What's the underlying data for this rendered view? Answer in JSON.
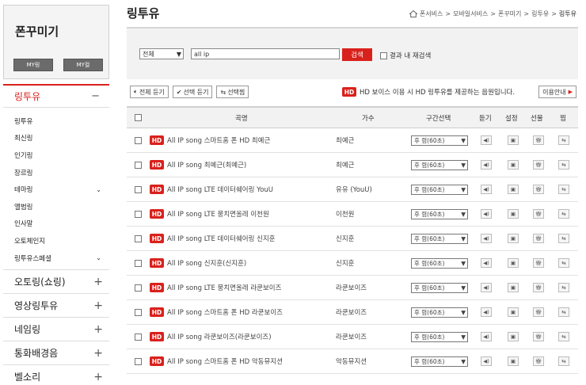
{
  "sidebar": {
    "title": "폰꾸미기",
    "btn1": "MY링",
    "btn2": "MY컬",
    "active_menu": {
      "label": "링투유",
      "sign": "−"
    },
    "sub_items": [
      {
        "label": "링투유",
        "chev": ""
      },
      {
        "label": "최신링",
        "chev": ""
      },
      {
        "label": "인기링",
        "chev": ""
      },
      {
        "label": "장르링",
        "chev": ""
      },
      {
        "label": "테마링",
        "chev": "⌄"
      },
      {
        "label": "앨범링",
        "chev": ""
      },
      {
        "label": "인사말",
        "chev": ""
      },
      {
        "label": "오토체인지",
        "chev": ""
      },
      {
        "label": "링투유스페셜",
        "chev": "⌄"
      }
    ],
    "menus": [
      {
        "label": "오토링(쇼링)",
        "sign": "+"
      },
      {
        "label": "영상링투유",
        "sign": "+"
      },
      {
        "label": "네임링",
        "sign": "+"
      },
      {
        "label": "통화배경음",
        "sign": "+"
      },
      {
        "label": "벨소리",
        "sign": "+"
      }
    ]
  },
  "main": {
    "title": "링투유",
    "breadcrumb": [
      "폰서비스",
      "모바일서비스",
      "폰꾸미기",
      "링투유",
      "링투유"
    ],
    "breadcrumb_sep": ">",
    "search": {
      "select_value": "전체",
      "input_value": "all ip",
      "button": "검색",
      "research_label": "결과 내 재검색"
    },
    "toolbar": {
      "listen_all": "전체 듣기",
      "listen_selected": "선택 듣기",
      "fav_selected": "선택찜"
    },
    "hd_badge": "HD",
    "hd_note": "HD 보이스 이용 시 HD 링투유를 제공하는 음원입니다.",
    "guide_button": "이용안내",
    "table": {
      "headers": {
        "title": "곡명",
        "singer": "가수",
        "range": "구간선택",
        "listen": "듣기",
        "set": "설정",
        "gift": "선물",
        "fav": "찜"
      },
      "range_value": "후 렴(60초)",
      "rows": [
        {
          "title": "All IP song 스마트홈 폰 HD 최예근",
          "singer": "최예근"
        },
        {
          "title": "All IP song 최예근(최예근)",
          "singer": "최예근"
        },
        {
          "title": "All IP song LTE 데이터쉐어링 YouU",
          "singer": "유유 (YouU)"
        },
        {
          "title": "All IP song LTE 뭉치면올레 이천원",
          "singer": "이천원"
        },
        {
          "title": "All IP song LTE 데이터쉐어링 신지훈",
          "singer": "신지훈"
        },
        {
          "title": "All IP song 신지훈(신지훈)",
          "singer": "신지훈"
        },
        {
          "title": "All IP song LTE 뭉치면올레 라쿤보이즈",
          "singer": "라쿤보이즈"
        },
        {
          "title": "All IP song 스마트홈 폰 HD 라쿤보이즈",
          "singer": "라쿤보이즈"
        },
        {
          "title": "All IP song 라쿤보이즈(라쿤보이즈)",
          "singer": "라쿤보이즈"
        },
        {
          "title": "All IP song 스마트홈 폰 HD 악동뮤지션",
          "singer": "악동뮤지션"
        }
      ]
    }
  }
}
